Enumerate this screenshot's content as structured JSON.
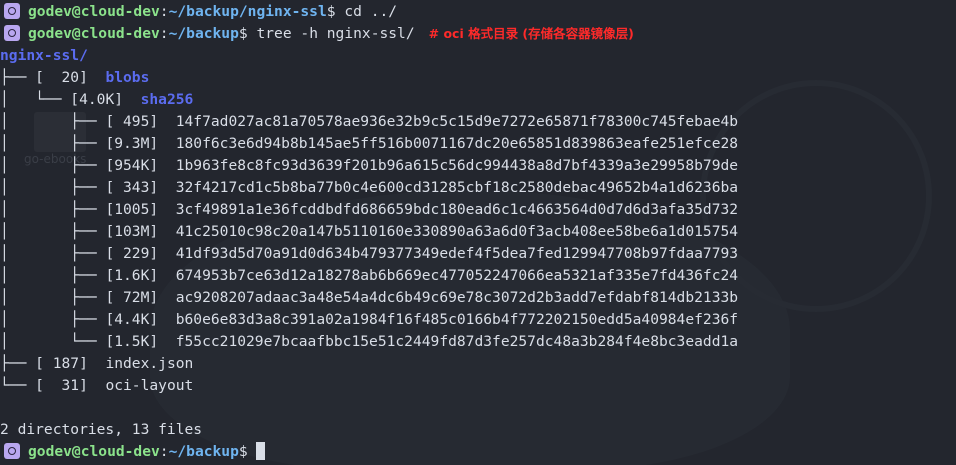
{
  "prompt": {
    "user_host": "godev@cloud-dev",
    "sep": ":"
  },
  "lines": {
    "l1": {
      "path": "~/backup/nginx-ssl",
      "symbol": "$",
      "command": " cd ../"
    },
    "l2": {
      "path": "~/backup",
      "symbol": "$",
      "command": " tree -h nginx-ssl/",
      "comment": "# oci 格式目录 (存储各容器镜像层)"
    },
    "root": "nginx-ssl/",
    "blobs": {
      "branch": "├── ",
      "size": "[  20]",
      "name": "blobs"
    },
    "sha": {
      "branch": "│   └── ",
      "size": "[4.0K]",
      "name": "sha256"
    },
    "files": [
      {
        "branch": "│       ├── ",
        "size": "[ 495]",
        "hash": "14f7ad027ac81a70578ae936e32b9c5c15d9e7272e65871f78300c745febae4b"
      },
      {
        "branch": "│       ├── ",
        "size": "[9.3M]",
        "hash": "180f6c3e6d94b8b145ae5ff516b0071167dc20e65851d839863eafe251efce28"
      },
      {
        "branch": "│       ├── ",
        "size": "[954K]",
        "hash": "1b963fe8c8fc93d3639f201b96a615c56dc994438a8d7bf4339a3e29958b79de"
      },
      {
        "branch": "│       ├── ",
        "size": "[ 343]",
        "hash": "32f4217cd1c5b8ba77b0c4e600cd31285cbf18c2580debac49652b4a1d6236ba"
      },
      {
        "branch": "│       ├── ",
        "size": "[1005]",
        "hash": "3cf49891a1e36fcddbdfd686659bdc180ead6c1c4663564d0d7d6d3afa35d732"
      },
      {
        "branch": "│       ├── ",
        "size": "[103M]",
        "hash": "41c25010c98c20a147b5110160e330890a63a6d0f3acb408ee58be6a1d015754"
      },
      {
        "branch": "│       ├── ",
        "size": "[ 229]",
        "hash": "41df93d5d70a91d0d634b479377349edef4f5dea7fed129947708b97fdaa7793"
      },
      {
        "branch": "│       ├── ",
        "size": "[1.6K]",
        "hash": "674953b7ce63d12a18278ab6b669ec477052247066ea5321af335e7fd436fc24"
      },
      {
        "branch": "│       ├── ",
        "size": "[ 72M]",
        "hash": "ac9208207adaac3a48e54a4dc6b49c69e78c3072d2b3add7efdabf814db2133b"
      },
      {
        "branch": "│       ├── ",
        "size": "[4.4K]",
        "hash": "b60e6e83d3a8c391a02a1984f16f485c0166b4f772202150edd5a40984ef236f"
      },
      {
        "branch": "│       └── ",
        "size": "[1.5K]",
        "hash": "f55cc21029e7bcaafbbc15e51c2449fd87d3fe257dc48a3b284f4e8bc3eadd1a"
      }
    ],
    "index": {
      "branch": "├── ",
      "size": "[ 187]",
      "name": "index.json"
    },
    "layout": {
      "branch": "└── ",
      "size": "[  31]",
      "name": "oci-layout"
    },
    "summary": "2 directories, 13 files",
    "l_last": {
      "path": "~/backup",
      "symbol": "$"
    }
  },
  "background": {
    "folder_label": "go-ebooks"
  }
}
